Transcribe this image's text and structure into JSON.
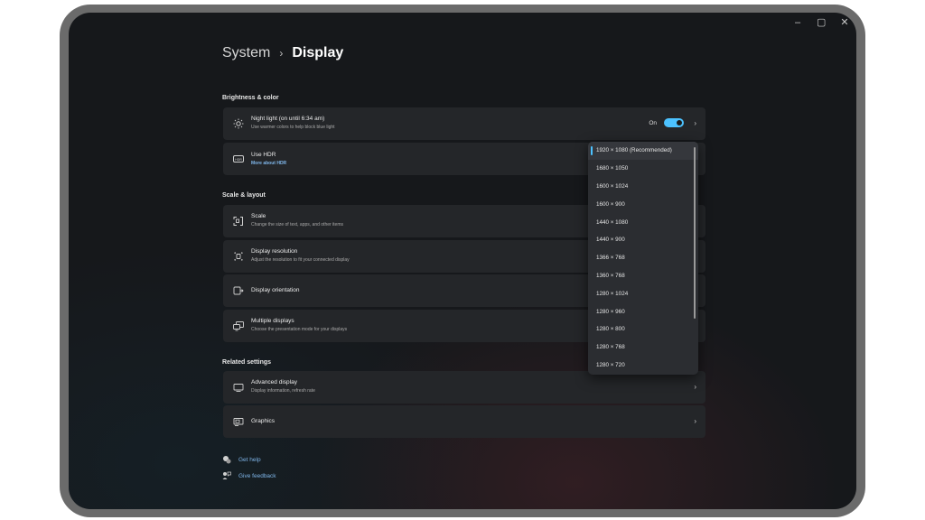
{
  "window_controls": {
    "minimize": "–",
    "maximize": "▢",
    "close": "✕"
  },
  "breadcrumb": {
    "parent": "System",
    "separator": "›",
    "current": "Display"
  },
  "sections": {
    "brightness": "Brightness & color",
    "scale": "Scale & layout",
    "related": "Related settings"
  },
  "night_light": {
    "title": "Night light (on until 6:34 am)",
    "subtitle": "Use warmer colors to help block blue light",
    "toggle_label": "On",
    "toggle_on": true
  },
  "hdr": {
    "title": "Use HDR",
    "link": "More about HDR"
  },
  "scale": {
    "title": "Scale",
    "subtitle": "Change the size of text, apps, and other items"
  },
  "resolution": {
    "title": "Display resolution",
    "subtitle": "Adjust the resolution to fit your connected display"
  },
  "orientation": {
    "title": "Display orientation"
  },
  "multiple": {
    "title": "Multiple displays",
    "subtitle": "Choose the presentation mode for your displays"
  },
  "advanced": {
    "title": "Advanced display",
    "subtitle": "Display information, refresh rate"
  },
  "graphics": {
    "title": "Graphics"
  },
  "resolution_options": [
    "1920 × 1080 (Recommended)",
    "1680 × 1050",
    "1600 × 1024",
    "1600 × 900",
    "1440 × 1080",
    "1440 × 900",
    "1366 × 768",
    "1360 × 768",
    "1280 × 1024",
    "1280 × 960",
    "1280 × 800",
    "1280 × 768",
    "1280 × 720"
  ],
  "selected_resolution_index": 0,
  "help": {
    "get_help": "Get help",
    "feedback": "Give feedback"
  },
  "colors": {
    "accent": "#4cc2ff",
    "card": "#242629",
    "background": "#16181b",
    "link": "#7fb6ea"
  }
}
